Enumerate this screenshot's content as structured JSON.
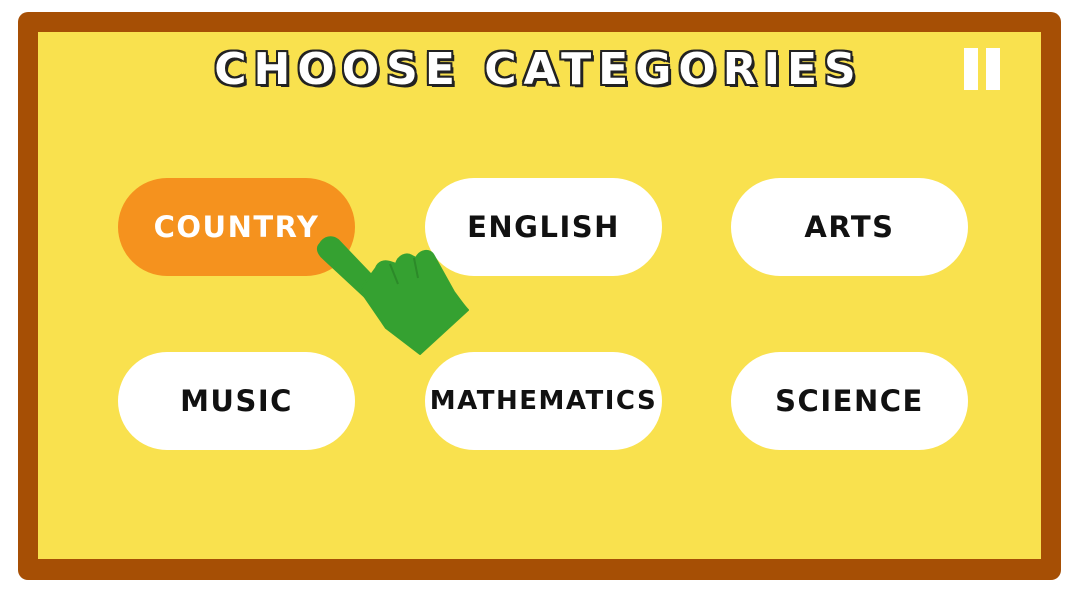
{
  "screen": {
    "title": "CHOOSE CATEGORIES"
  },
  "pause_button": {
    "icon": "pause-icon"
  },
  "categories": [
    {
      "label": "COUNTRY",
      "selected": true
    },
    {
      "label": "ENGLISH",
      "selected": false
    },
    {
      "label": "ARTS",
      "selected": false
    },
    {
      "label": "MUSIC",
      "selected": false
    },
    {
      "label": "MATHEMATICS",
      "selected": false
    },
    {
      "label": "SCIENCE",
      "selected": false
    }
  ],
  "pointer": {
    "icon": "pointing-hand-icon"
  },
  "colors": {
    "frame": "#a64f05",
    "board": "#f9e14e",
    "button": "#ffffff",
    "selected_button": "#f5921e",
    "hand": "#35a131"
  }
}
